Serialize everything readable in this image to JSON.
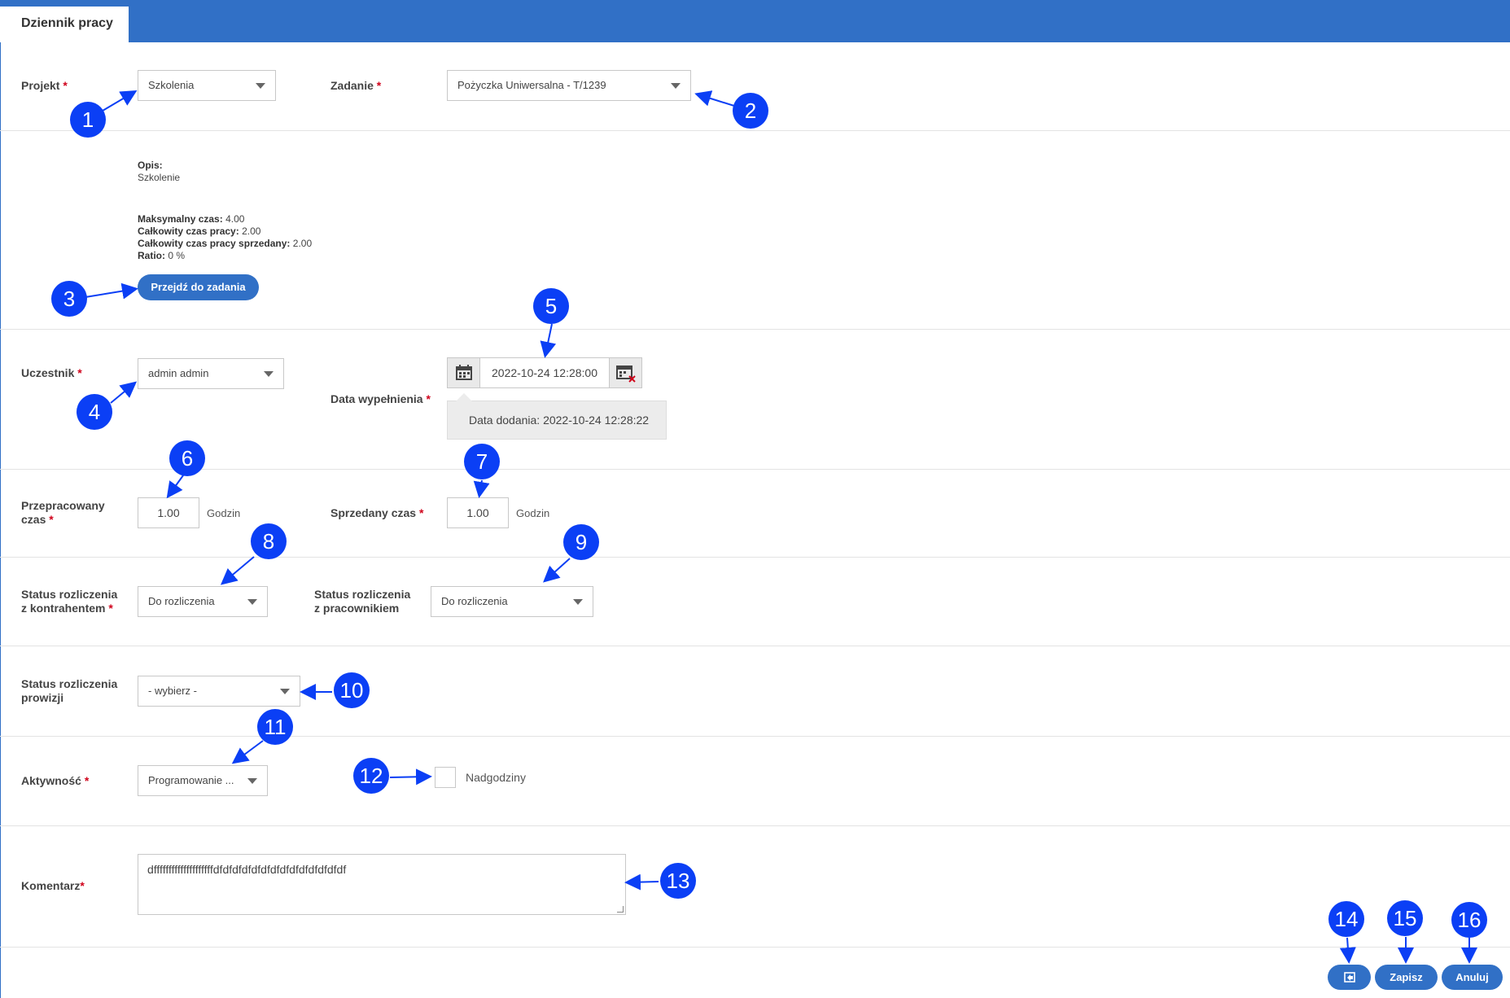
{
  "header": {
    "tab_label": "Dziennik pracy",
    "accent": "#3170c6"
  },
  "form": {
    "projekt": {
      "label": "Projekt",
      "required": "*",
      "value": "Szkolenia"
    },
    "zadanie": {
      "label": "Zadanie",
      "required": "*",
      "value": "Pożyczka Uniwersalna - T/1239"
    },
    "info": {
      "opis_label": "Opis:",
      "opis_value": "Szkolenie",
      "max_time_label": "Maksymalny czas:",
      "max_time_value": "4.00",
      "total_time_label": "Całkowity czas pracy:",
      "total_time_value": "2.00",
      "total_sold_label": "Całkowity czas pracy sprzedany:",
      "total_sold_value": "2.00",
      "ratio_label": "Ratio:",
      "ratio_value": "0 %",
      "go_to_task_button": "Przejdź do zadania"
    },
    "uczestnik": {
      "label": "Uczestnik",
      "required": "*",
      "value": "admin admin"
    },
    "data_wypelnienia": {
      "label": "Data wypełnienia",
      "required": "*",
      "value": "2022-10-24 12:28:00",
      "tooltip": "Data dodania: 2022-10-24 12:28:22"
    },
    "przepracowany": {
      "label_line1": "Przepracowany",
      "label_line2": "czas",
      "required": "*",
      "value": "1.00",
      "unit": "Godzin"
    },
    "sprzedany": {
      "label": "Sprzedany czas",
      "required": "*",
      "value": "1.00",
      "unit": "Godzin"
    },
    "status_kontrahent": {
      "label_line1": "Status rozliczenia",
      "label_line2": "z kontrahentem",
      "required": "*",
      "value": "Do rozliczenia"
    },
    "status_pracownik": {
      "label_line1": "Status rozliczenia",
      "label_line2": "z pracownikiem",
      "value": "Do rozliczenia"
    },
    "status_prowizji": {
      "label_line1": "Status rozliczenia",
      "label_line2": "prowizji",
      "value": "- wybierz -"
    },
    "aktywnosc": {
      "label": "Aktywność",
      "required": "*",
      "value": "Programowanie ..."
    },
    "nadgodziny": {
      "label": "Nadgodziny",
      "checked": false
    },
    "komentarz": {
      "label": "Komentarz",
      "required": "*",
      "value": "dffffffffffffffffffffdfdfdfdfdfdfdfdfdfdfdfdfdfdf"
    }
  },
  "footer": {
    "icon_button": "back-icon",
    "save": "Zapisz",
    "cancel": "Anuluj"
  },
  "callouts": [
    "1",
    "2",
    "3",
    "4",
    "5",
    "6",
    "7",
    "8",
    "9",
    "10",
    "11",
    "12",
    "13",
    "14",
    "15",
    "16"
  ],
  "callout_color": "#0b3ff5"
}
